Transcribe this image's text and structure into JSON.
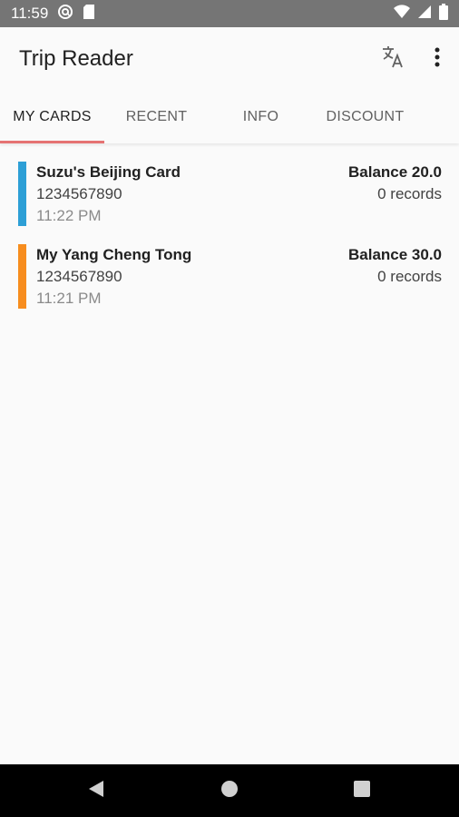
{
  "status_bar": {
    "time": "11:59",
    "icons": [
      "at-sign-icon",
      "sd-card-icon",
      "wifi-icon",
      "signal-icon",
      "battery-icon"
    ]
  },
  "app_bar": {
    "title": "Trip Reader",
    "actions": [
      "translate-icon",
      "more-vert-icon"
    ]
  },
  "tabs": [
    {
      "label": "MY CARDS",
      "active": true
    },
    {
      "label": "RECENT",
      "active": false
    },
    {
      "label": "INFO",
      "active": false
    },
    {
      "label": "DISCOUNT",
      "active": false
    }
  ],
  "cards": [
    {
      "name": "Suzu's Beijing Card",
      "number": "1234567890",
      "time": "11:22 PM",
      "balance": "Balance 20.0",
      "records": "0 records",
      "color": "#2d9fd6"
    },
    {
      "name": "My Yang Cheng Tong",
      "number": "1234567890",
      "time": "11:21 PM",
      "balance": "Balance 30.0",
      "records": "0 records",
      "color": "#f78d1e"
    }
  ],
  "colors": {
    "accent": "#e57373",
    "status_bar": "#757575",
    "nav_bar": "#000000"
  },
  "nav_bar": {
    "buttons": [
      "back-icon",
      "home-icon",
      "recents-icon"
    ]
  }
}
